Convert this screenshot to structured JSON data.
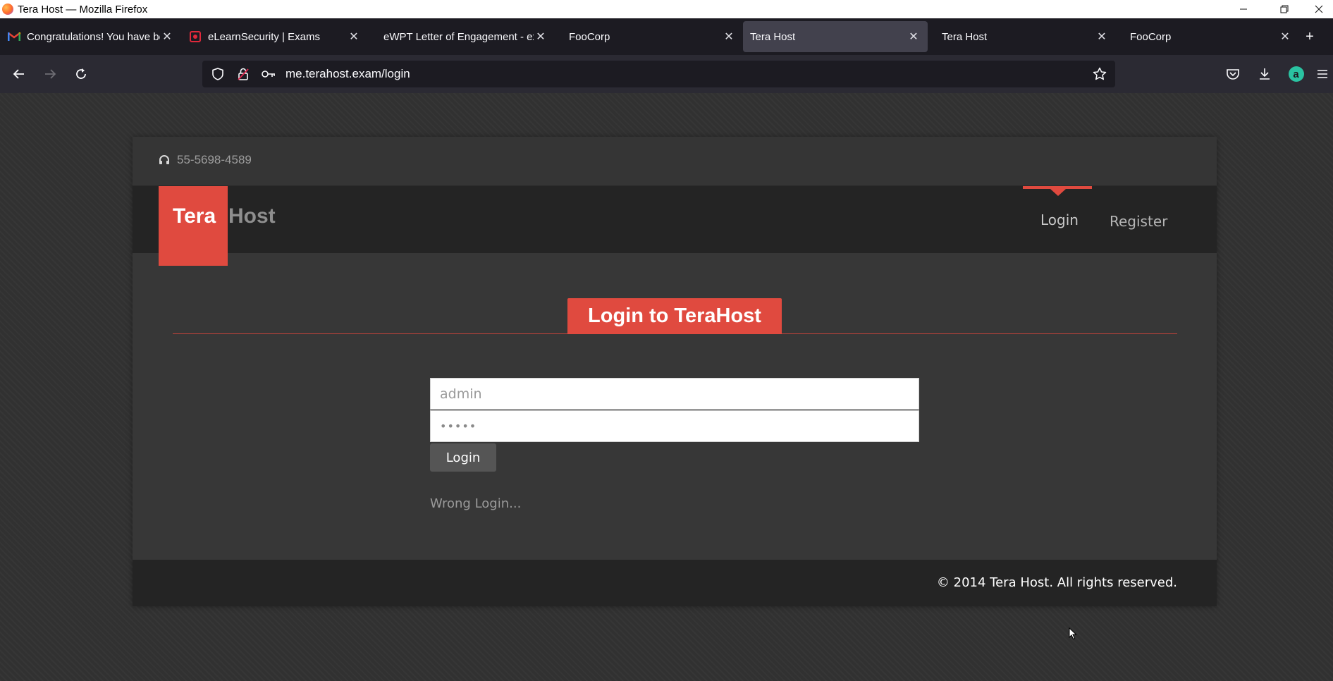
{
  "window": {
    "title": "Tera Host — Mozilla Firefox",
    "controls": [
      "minimize-icon",
      "restore-icon",
      "close-icon"
    ]
  },
  "tabs": [
    {
      "label": "Congratulations! You have bee",
      "icon": "gmail-icon",
      "active": false
    },
    {
      "label": "eLearnSecurity | Exams",
      "icon": "elearnsecurity-icon",
      "active": false
    },
    {
      "label": "eWPT Letter of Engagement - exa",
      "icon": "",
      "active": false
    },
    {
      "label": "FooCorp",
      "icon": "",
      "active": false
    },
    {
      "label": "Tera Host",
      "icon": "",
      "active": true
    },
    {
      "label": "Tera Host",
      "icon": "",
      "active": false
    },
    {
      "label": "FooCorp",
      "icon": "",
      "active": false
    }
  ],
  "toolbar": {
    "url": "me.terahost.exam/login"
  },
  "site": {
    "phone": "55-5698-4589",
    "logo_part1": "Tera",
    "logo_part2": "Host",
    "nav": {
      "login": "Login",
      "register": "Register"
    },
    "section_title": "Login to TeraHost",
    "form": {
      "username_value": "admin",
      "password_value": "•••••",
      "submit_label": "Login",
      "error_message": "Wrong Login..."
    },
    "footer": "© 2014 Tera Host. All rights reserved."
  },
  "colors": {
    "accent": "#e04a3f",
    "header_bg": "#242424",
    "content_bg": "#373737"
  }
}
